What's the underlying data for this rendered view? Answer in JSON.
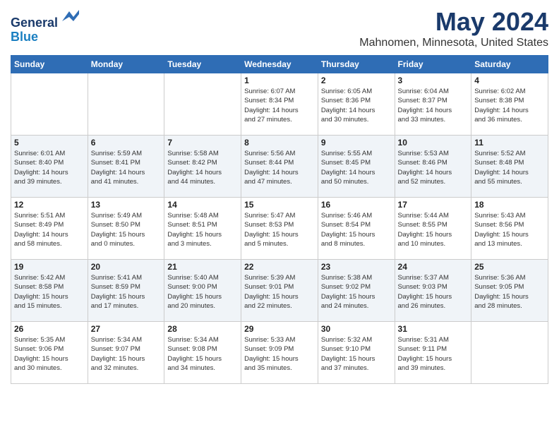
{
  "header": {
    "logo_line1": "General",
    "logo_line2": "Blue",
    "title": "May 2024",
    "subtitle": "Mahnomen, Minnesota, United States"
  },
  "days_of_week": [
    "Sunday",
    "Monday",
    "Tuesday",
    "Wednesday",
    "Thursday",
    "Friday",
    "Saturday"
  ],
  "weeks": [
    [
      {
        "day": "",
        "info": ""
      },
      {
        "day": "",
        "info": ""
      },
      {
        "day": "",
        "info": ""
      },
      {
        "day": "1",
        "info": "Sunrise: 6:07 AM\nSunset: 8:34 PM\nDaylight: 14 hours\nand 27 minutes."
      },
      {
        "day": "2",
        "info": "Sunrise: 6:05 AM\nSunset: 8:36 PM\nDaylight: 14 hours\nand 30 minutes."
      },
      {
        "day": "3",
        "info": "Sunrise: 6:04 AM\nSunset: 8:37 PM\nDaylight: 14 hours\nand 33 minutes."
      },
      {
        "day": "4",
        "info": "Sunrise: 6:02 AM\nSunset: 8:38 PM\nDaylight: 14 hours\nand 36 minutes."
      }
    ],
    [
      {
        "day": "5",
        "info": "Sunrise: 6:01 AM\nSunset: 8:40 PM\nDaylight: 14 hours\nand 39 minutes."
      },
      {
        "day": "6",
        "info": "Sunrise: 5:59 AM\nSunset: 8:41 PM\nDaylight: 14 hours\nand 41 minutes."
      },
      {
        "day": "7",
        "info": "Sunrise: 5:58 AM\nSunset: 8:42 PM\nDaylight: 14 hours\nand 44 minutes."
      },
      {
        "day": "8",
        "info": "Sunrise: 5:56 AM\nSunset: 8:44 PM\nDaylight: 14 hours\nand 47 minutes."
      },
      {
        "day": "9",
        "info": "Sunrise: 5:55 AM\nSunset: 8:45 PM\nDaylight: 14 hours\nand 50 minutes."
      },
      {
        "day": "10",
        "info": "Sunrise: 5:53 AM\nSunset: 8:46 PM\nDaylight: 14 hours\nand 52 minutes."
      },
      {
        "day": "11",
        "info": "Sunrise: 5:52 AM\nSunset: 8:48 PM\nDaylight: 14 hours\nand 55 minutes."
      }
    ],
    [
      {
        "day": "12",
        "info": "Sunrise: 5:51 AM\nSunset: 8:49 PM\nDaylight: 14 hours\nand 58 minutes."
      },
      {
        "day": "13",
        "info": "Sunrise: 5:49 AM\nSunset: 8:50 PM\nDaylight: 15 hours\nand 0 minutes."
      },
      {
        "day": "14",
        "info": "Sunrise: 5:48 AM\nSunset: 8:51 PM\nDaylight: 15 hours\nand 3 minutes."
      },
      {
        "day": "15",
        "info": "Sunrise: 5:47 AM\nSunset: 8:53 PM\nDaylight: 15 hours\nand 5 minutes."
      },
      {
        "day": "16",
        "info": "Sunrise: 5:46 AM\nSunset: 8:54 PM\nDaylight: 15 hours\nand 8 minutes."
      },
      {
        "day": "17",
        "info": "Sunrise: 5:44 AM\nSunset: 8:55 PM\nDaylight: 15 hours\nand 10 minutes."
      },
      {
        "day": "18",
        "info": "Sunrise: 5:43 AM\nSunset: 8:56 PM\nDaylight: 15 hours\nand 13 minutes."
      }
    ],
    [
      {
        "day": "19",
        "info": "Sunrise: 5:42 AM\nSunset: 8:58 PM\nDaylight: 15 hours\nand 15 minutes."
      },
      {
        "day": "20",
        "info": "Sunrise: 5:41 AM\nSunset: 8:59 PM\nDaylight: 15 hours\nand 17 minutes."
      },
      {
        "day": "21",
        "info": "Sunrise: 5:40 AM\nSunset: 9:00 PM\nDaylight: 15 hours\nand 20 minutes."
      },
      {
        "day": "22",
        "info": "Sunrise: 5:39 AM\nSunset: 9:01 PM\nDaylight: 15 hours\nand 22 minutes."
      },
      {
        "day": "23",
        "info": "Sunrise: 5:38 AM\nSunset: 9:02 PM\nDaylight: 15 hours\nand 24 minutes."
      },
      {
        "day": "24",
        "info": "Sunrise: 5:37 AM\nSunset: 9:03 PM\nDaylight: 15 hours\nand 26 minutes."
      },
      {
        "day": "25",
        "info": "Sunrise: 5:36 AM\nSunset: 9:05 PM\nDaylight: 15 hours\nand 28 minutes."
      }
    ],
    [
      {
        "day": "26",
        "info": "Sunrise: 5:35 AM\nSunset: 9:06 PM\nDaylight: 15 hours\nand 30 minutes."
      },
      {
        "day": "27",
        "info": "Sunrise: 5:34 AM\nSunset: 9:07 PM\nDaylight: 15 hours\nand 32 minutes."
      },
      {
        "day": "28",
        "info": "Sunrise: 5:34 AM\nSunset: 9:08 PM\nDaylight: 15 hours\nand 34 minutes."
      },
      {
        "day": "29",
        "info": "Sunrise: 5:33 AM\nSunset: 9:09 PM\nDaylight: 15 hours\nand 35 minutes."
      },
      {
        "day": "30",
        "info": "Sunrise: 5:32 AM\nSunset: 9:10 PM\nDaylight: 15 hours\nand 37 minutes."
      },
      {
        "day": "31",
        "info": "Sunrise: 5:31 AM\nSunset: 9:11 PM\nDaylight: 15 hours\nand 39 minutes."
      },
      {
        "day": "",
        "info": ""
      }
    ]
  ]
}
